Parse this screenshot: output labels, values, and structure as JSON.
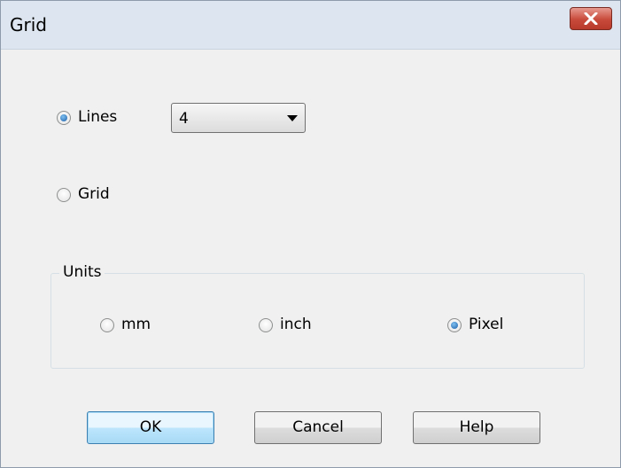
{
  "window": {
    "title": "Grid",
    "close_icon": "close-x-icon"
  },
  "mode": {
    "lines_label": "Lines",
    "lines_checked": true,
    "lines_value": "4",
    "grid_label": "Grid",
    "grid_checked": false
  },
  "units": {
    "title": "Units",
    "options": [
      {
        "label": "mm",
        "checked": false
      },
      {
        "label": "inch",
        "checked": false
      },
      {
        "label": "Pixel",
        "checked": true
      }
    ]
  },
  "buttons": {
    "ok": "OK",
    "cancel": "Cancel",
    "help": "Help"
  },
  "colors": {
    "close_button": "#c84a3a",
    "default_button": "#3c7fb1"
  }
}
